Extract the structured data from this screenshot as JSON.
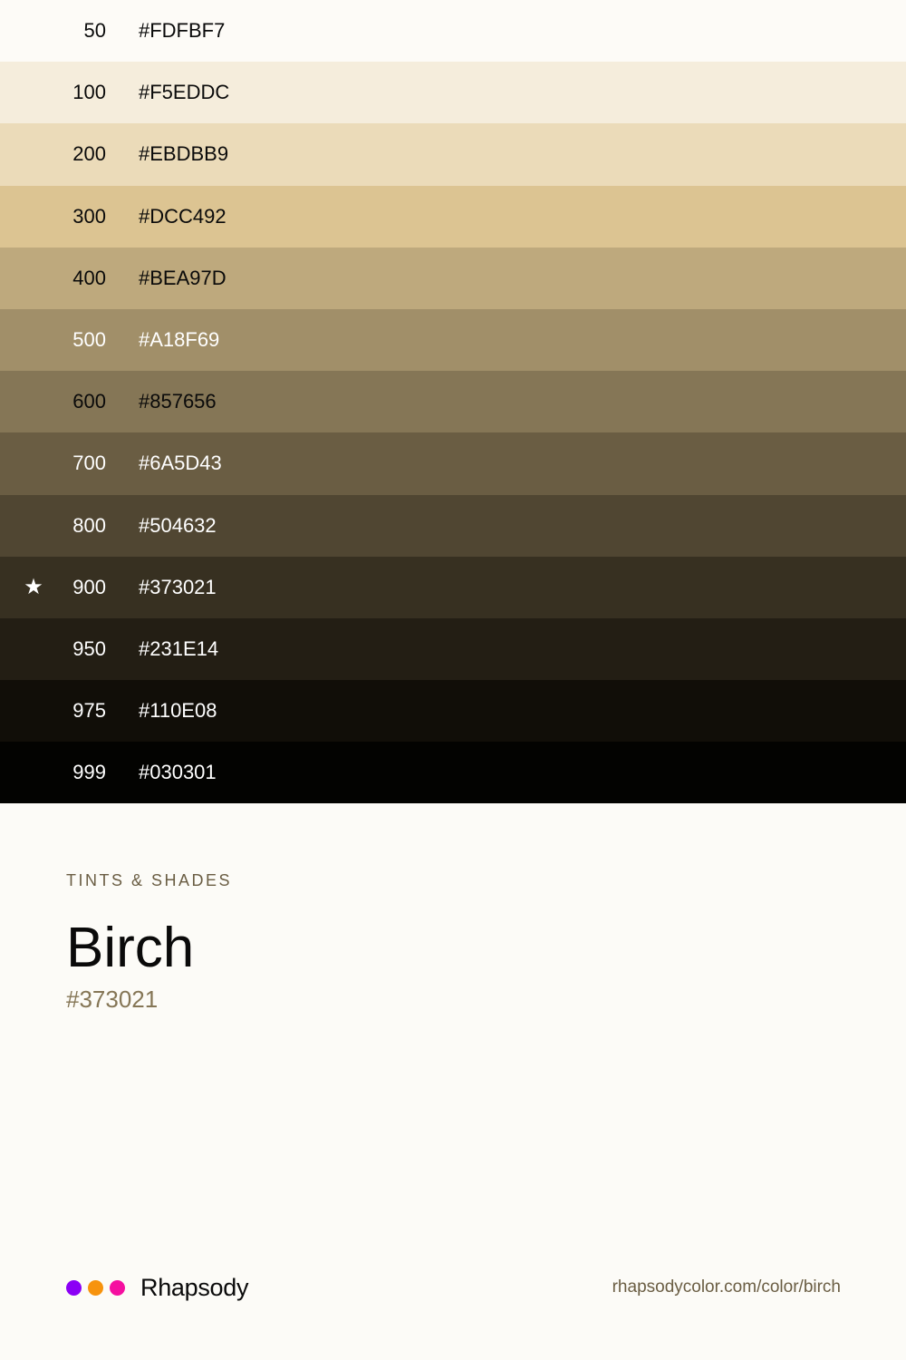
{
  "swatches": [
    {
      "step": "50",
      "hex": "#FDFBF7",
      "text_color": "#0a0a0a",
      "starred": false
    },
    {
      "step": "100",
      "hex": "#F5EDDC",
      "text_color": "#0a0a0a",
      "starred": false
    },
    {
      "step": "200",
      "hex": "#EBDBB9",
      "text_color": "#0a0a0a",
      "starred": false
    },
    {
      "step": "300",
      "hex": "#DCC492",
      "text_color": "#0a0a0a",
      "starred": false
    },
    {
      "step": "400",
      "hex": "#BEA97D",
      "text_color": "#0a0a0a",
      "starred": false
    },
    {
      "step": "500",
      "hex": "#A18F69",
      "text_color": "#ffffff",
      "starred": false
    },
    {
      "step": "600",
      "hex": "#857656",
      "text_color": "#0a0a0a",
      "starred": false
    },
    {
      "step": "700",
      "hex": "#6A5D43",
      "text_color": "#ffffff",
      "starred": false
    },
    {
      "step": "800",
      "hex": "#504632",
      "text_color": "#ffffff",
      "starred": false
    },
    {
      "step": "900",
      "hex": "#373021",
      "text_color": "#ffffff",
      "starred": true
    },
    {
      "step": "950",
      "hex": "#231E14",
      "text_color": "#ffffff",
      "starred": false
    },
    {
      "step": "975",
      "hex": "#110E08",
      "text_color": "#ffffff",
      "starred": false
    },
    {
      "step": "999",
      "hex": "#030301",
      "text_color": "#ffffff",
      "starred": false
    }
  ],
  "star_glyph": "★",
  "info": {
    "eyebrow": "TINTS & SHADES",
    "name": "Birch",
    "hex": "#373021"
  },
  "footer": {
    "brand_dots": [
      "#8B00F5",
      "#F7930D",
      "#F50FA0"
    ],
    "brand_name": "Rhapsody",
    "url": "rhapsodycolor.com/color/birch"
  }
}
